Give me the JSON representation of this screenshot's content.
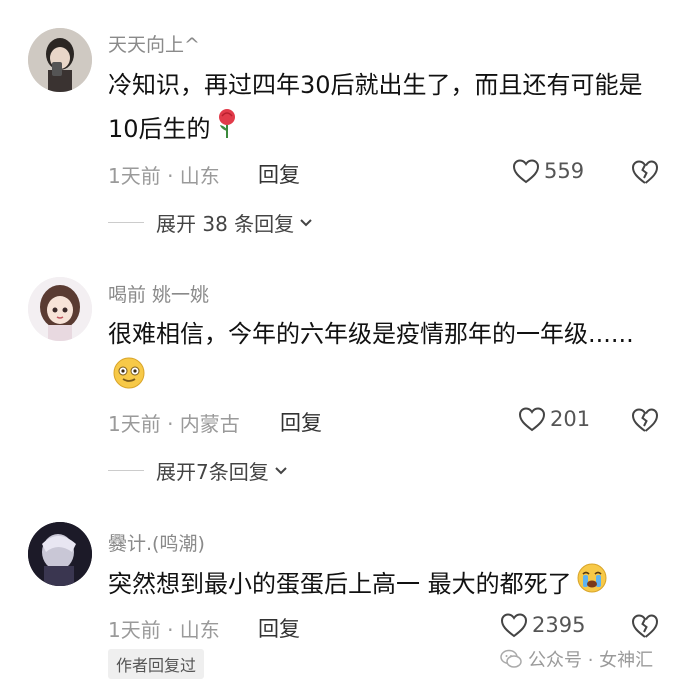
{
  "comments": [
    {
      "username": "天天向上^",
      "text": "冷知识，再过四年30后就出生了，而且还有可能是10后生的",
      "emoji": "rose",
      "meta": "1天前 · 山东",
      "reply_label": "回复",
      "likes": "559",
      "expand_label": "展开 38 条回复",
      "avatar": "avatar-photo"
    },
    {
      "username": "喝前 姚一姚",
      "text": "很难相信，今年的六年级是疫情那年的一年级......",
      "emoji": "smile",
      "meta": "1天前 · 内蒙古",
      "reply_label": "回复",
      "likes": "201",
      "expand_label": "展开7条回复",
      "avatar": "avatar-girl"
    },
    {
      "username": "爨计.(鸣潮)",
      "text": "突然想到最小的蛋蛋后上高一  最大的都死了",
      "emoji": "crying",
      "meta": "1天前 · 山东",
      "reply_label": "回复",
      "likes": "2395",
      "author_badge": "作者回复过",
      "avatar": "avatar-dark"
    }
  ],
  "watermark": {
    "text": "公众号 · 女神汇",
    "icon": "wechat-icon"
  },
  "colors": {
    "text": "#111111",
    "muted": "#9a9a9a",
    "background": "#ffffff"
  }
}
